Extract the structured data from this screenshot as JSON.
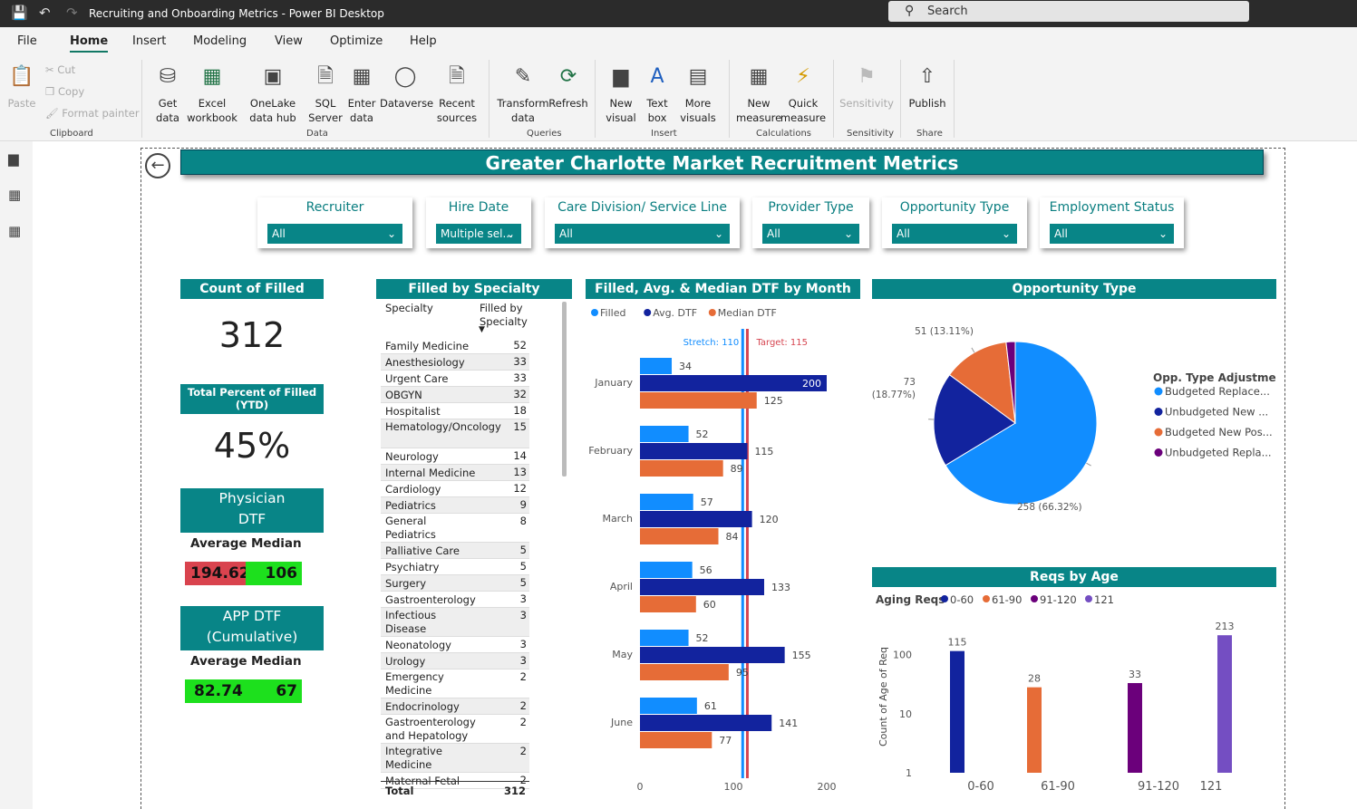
{
  "window": {
    "title": "Recruiting and Onboarding Metrics - Power BI Desktop",
    "search_label": "Search"
  },
  "menu": [
    "File",
    "Home",
    "Insert",
    "Modeling",
    "View",
    "Optimize",
    "Help"
  ],
  "ribbon": {
    "paste": "Paste",
    "cut": "Cut",
    "copy": "Copy",
    "format_painter": "Format painter",
    "get_data": "Get data",
    "excel": "Excel workbook",
    "onelake": "OneLake data hub",
    "sql": "SQL Server",
    "enter_data": "Enter data",
    "dataverse": "Dataverse",
    "recent": "Recent sources",
    "transform": "Transform data",
    "refresh": "Refresh",
    "new_visual": "New visual",
    "text_box": "Text box",
    "more_visuals": "More visuals",
    "new_measure": "New measure",
    "quick_measure": "Quick measure",
    "sensitivity": "Sensitivity",
    "publish": "Publish",
    "groups": {
      "clipboard": "Clipboard",
      "data": "Data",
      "queries": "Queries",
      "insert": "Insert",
      "calculations": "Calculations",
      "sensitivity": "Sensitivity",
      "share": "Share"
    }
  },
  "report": {
    "title": "Greater Charlotte Market Recruitment Metrics",
    "slicers": [
      {
        "label": "Recruiter",
        "value": "All"
      },
      {
        "label": "Hire Date",
        "value": "Multiple sel..."
      },
      {
        "label": "Care Division/ Service Line",
        "value": "All"
      },
      {
        "label": "Provider Type",
        "value": "All"
      },
      {
        "label": "Opportunity Type",
        "value": "All"
      },
      {
        "label": "Employment Status",
        "value": "All"
      }
    ],
    "count_filled": {
      "title": "Count of Filled (YTD)",
      "value": "312"
    },
    "pct_filled": {
      "title": "Total Percent of Filled (YTD)",
      "value": "45%"
    },
    "physician_dtf": {
      "title": "Physician DTF (Cumulative)",
      "avg_label": "Average",
      "median_label": "Median",
      "avg": "194.62",
      "median": "106",
      "avg_color": "#d9434e",
      "median_color": "#1de01d"
    },
    "app_dtf": {
      "title": "APP DTF (Cumulative)",
      "avg_label": "Average",
      "median_label": "Median",
      "avg": "82.74",
      "median": "67",
      "avg_color": "#1de01d",
      "median_color": "#1de01d"
    },
    "specialty_table": {
      "title": "Filled by Specialty",
      "col1": "Specialty",
      "col2": "Filled by Specialty",
      "rows": [
        [
          "Family Medicine",
          "52"
        ],
        [
          "Anesthesiology",
          "33"
        ],
        [
          "Urgent Care",
          "33"
        ],
        [
          "OBGYN",
          "32"
        ],
        [
          "Hospitalist",
          "18"
        ],
        [
          "Hematology/Oncology",
          "15"
        ],
        [
          "Neurology",
          "14"
        ],
        [
          "Internal Medicine",
          "13"
        ],
        [
          "Cardiology",
          "12"
        ],
        [
          "Pediatrics",
          "9"
        ],
        [
          "General Pediatrics",
          "8"
        ],
        [
          "Palliative Care",
          "5"
        ],
        [
          "Psychiatry",
          "5"
        ],
        [
          "Surgery",
          "5"
        ],
        [
          "Gastroenterology",
          "3"
        ],
        [
          "Infectious Disease",
          "3"
        ],
        [
          "Neonatology",
          "3"
        ],
        [
          "Urology",
          "3"
        ],
        [
          "Emergency Medicine",
          "2"
        ],
        [
          "Endocrinology",
          "2"
        ],
        [
          "Gastroenterology and Hepatology",
          "2"
        ],
        [
          "Integrative Medicine",
          "2"
        ],
        [
          "Maternal Fetal",
          "2"
        ]
      ],
      "total_label": "Total",
      "total_value": "312"
    }
  },
  "chart_data": [
    {
      "type": "bar",
      "title": "Filled, Avg. & Median DTF by Month",
      "orientation": "horizontal",
      "categories": [
        "January",
        "February",
        "March",
        "April",
        "May",
        "June"
      ],
      "series": [
        {
          "name": "Filled",
          "color": "#118dff",
          "values": [
            34,
            52,
            57,
            56,
            52,
            61
          ]
        },
        {
          "name": "Avg. DTF",
          "color": "#12239e",
          "values": [
            200,
            115,
            120,
            133,
            155,
            141
          ]
        },
        {
          "name": "Median DTF",
          "color": "#e66c37",
          "values": [
            125,
            89,
            84,
            60,
            95,
            77
          ]
        }
      ],
      "reference_lines": [
        {
          "label": "Stretch: 110",
          "value": 110,
          "color": "#118dff"
        },
        {
          "label": "Target: 115",
          "value": 115,
          "color": "#d64550"
        }
      ],
      "xticks": [
        "0",
        "100",
        "200"
      ],
      "xlim": [
        0,
        200
      ],
      "legend": "top-left"
    },
    {
      "type": "pie",
      "title": "Opportunity Type",
      "legend_title": "Opp. Type Adjustment",
      "slices": [
        {
          "name": "Budgeted Replace...",
          "value": 258,
          "label": "258 (66.32%)",
          "color": "#118dff"
        },
        {
          "name": "Unbudgeted New ...",
          "value": 73,
          "label": "73 (18.77%)",
          "color": "#12239e"
        },
        {
          "name": "Budgeted New Pos...",
          "value": 51,
          "label": "51 (13.11%)",
          "color": "#e66c37"
        },
        {
          "name": "Unbudgeted Repla...",
          "value": 7,
          "label": "",
          "color": "#6b007b"
        }
      ],
      "legend": "right"
    },
    {
      "type": "bar",
      "title": "Reqs by Age",
      "legend_title": "Aging Reqs",
      "categories": [
        "0-60",
        "61-90",
        "91-120",
        "121"
      ],
      "values": [
        115,
        28,
        33,
        213
      ],
      "colors": [
        "#12239e",
        "#e66c37",
        "#6b007b",
        "#744ec2"
      ],
      "ylabel": "Count of Age of Req",
      "yscale": "log",
      "yticks": [
        "1",
        "10",
        "100"
      ],
      "legend": "top-left"
    }
  ]
}
